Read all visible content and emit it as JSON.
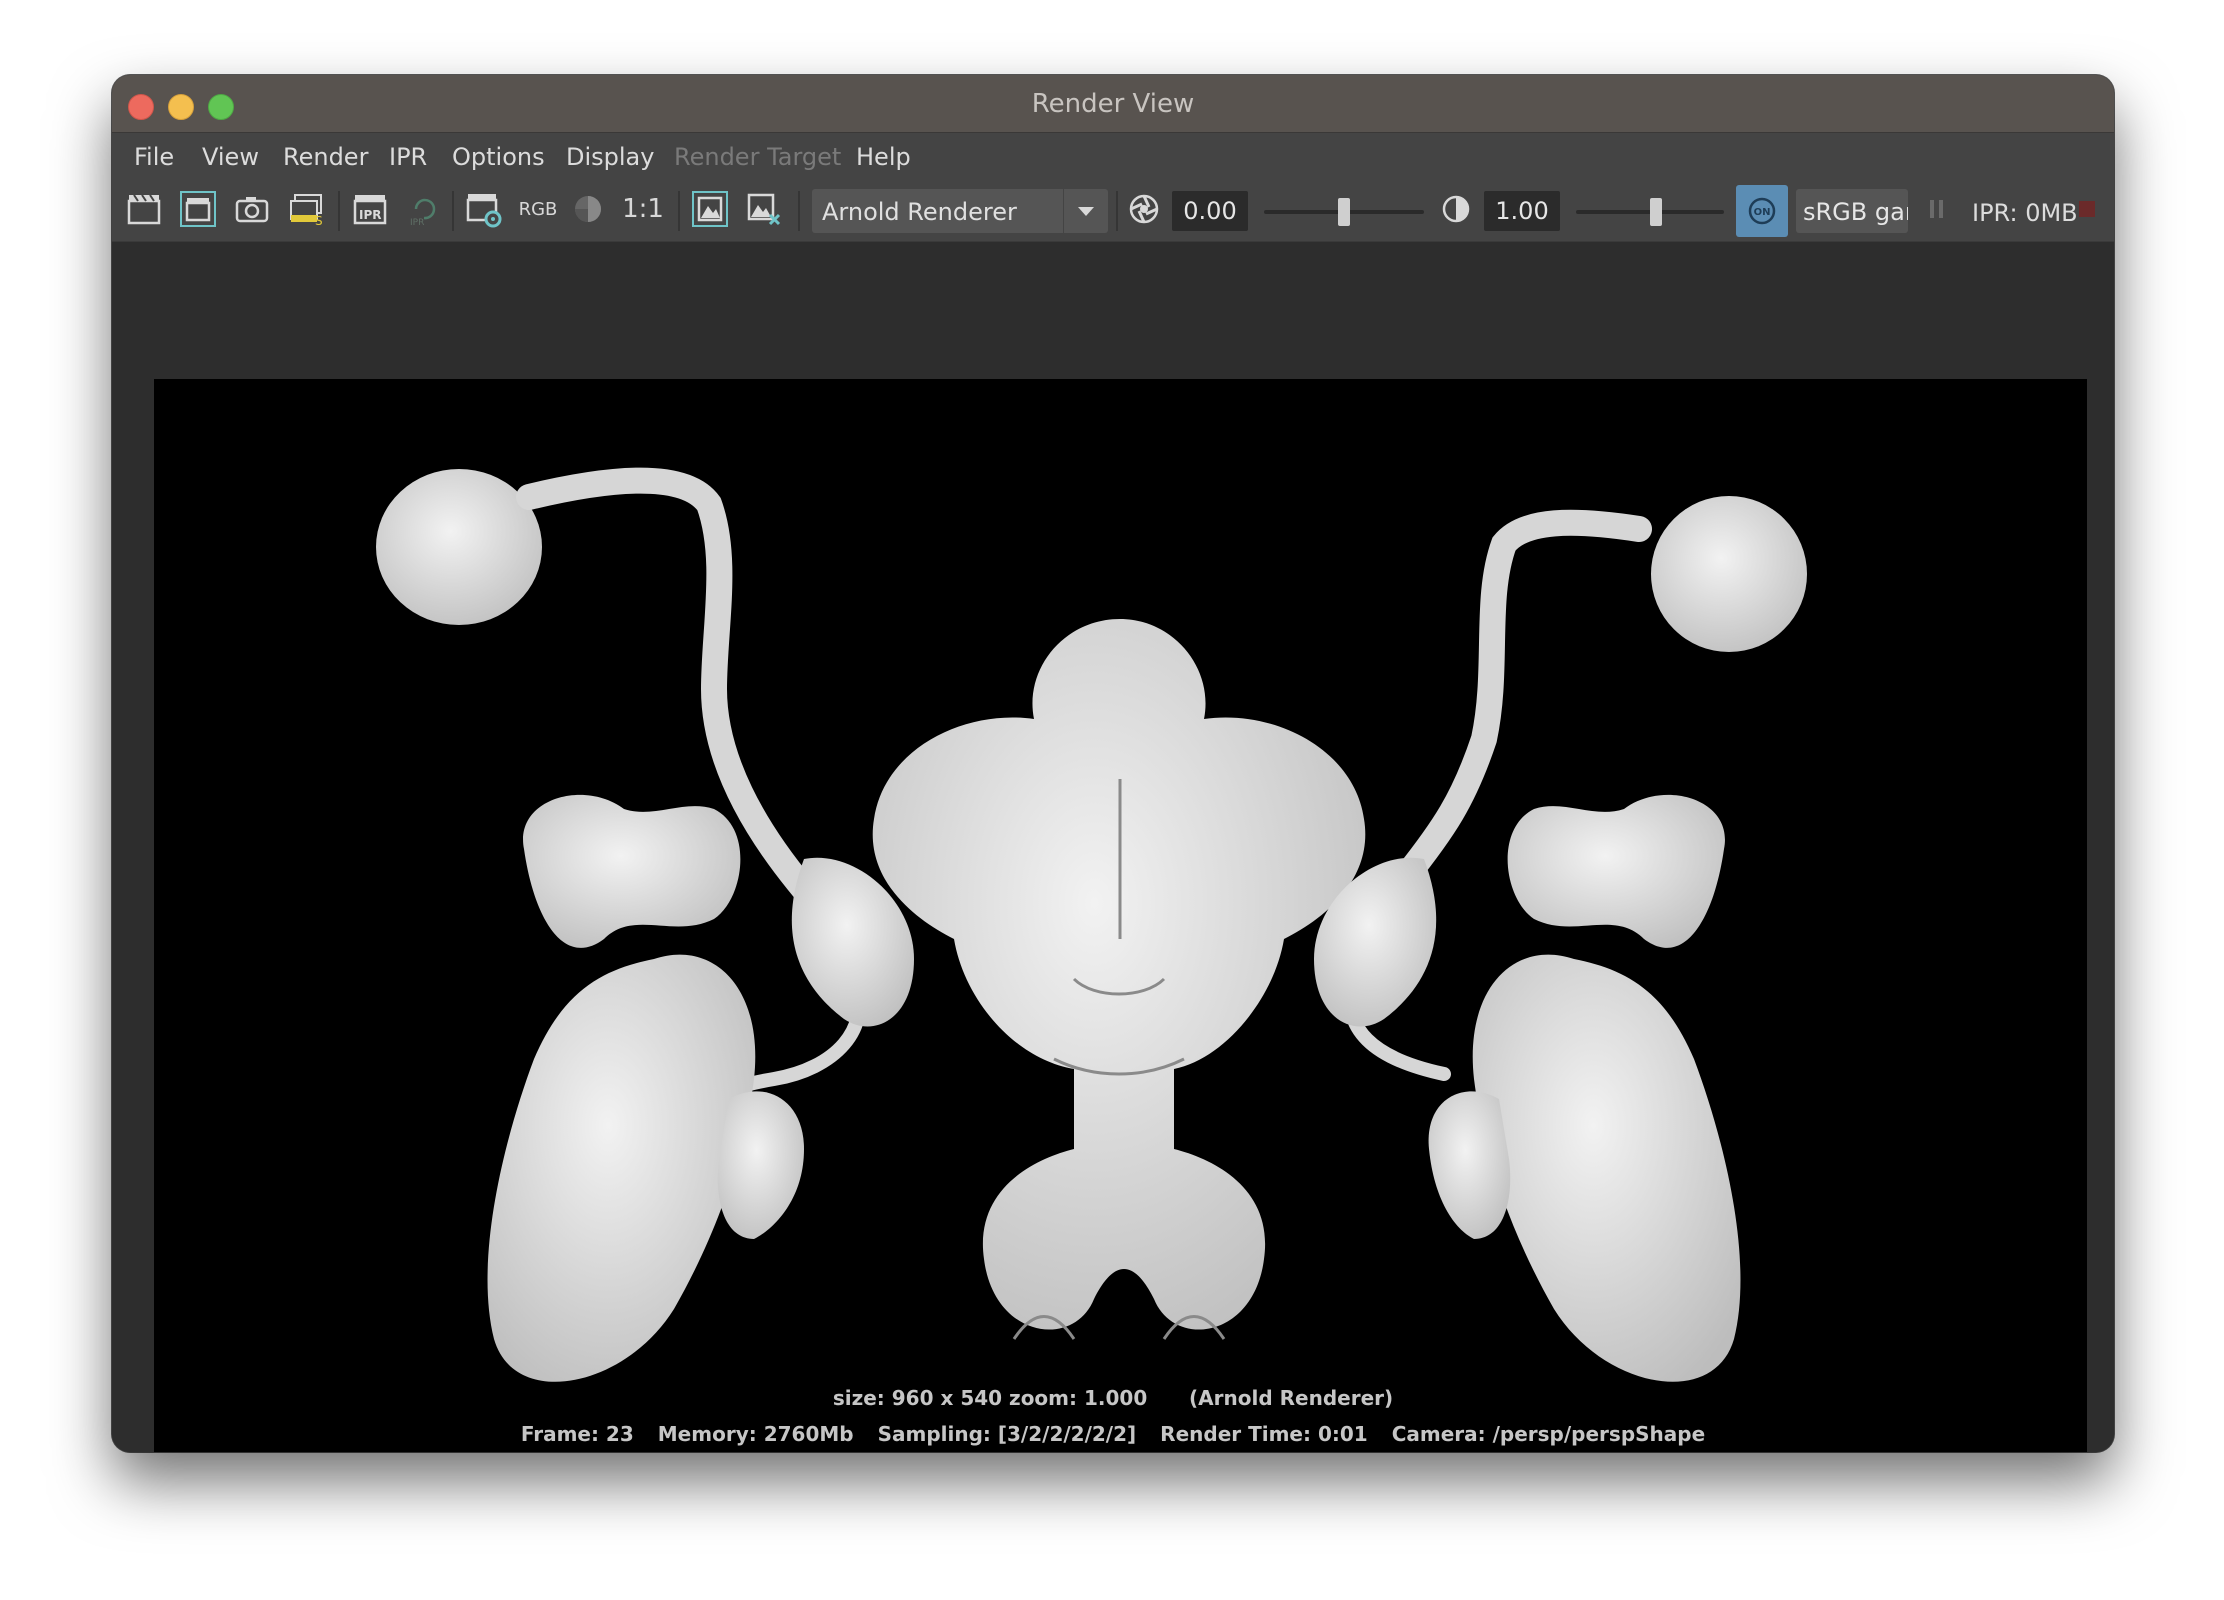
{
  "window": {
    "title": "Render View"
  },
  "menu": {
    "items": [
      {
        "label": "File",
        "enabled": true
      },
      {
        "label": "View",
        "enabled": true
      },
      {
        "label": "Render",
        "enabled": true
      },
      {
        "label": "IPR",
        "enabled": true
      },
      {
        "label": "Options",
        "enabled": true
      },
      {
        "label": "Display",
        "enabled": true
      },
      {
        "label": "Render Target",
        "enabled": false
      },
      {
        "label": "Help",
        "enabled": true
      }
    ]
  },
  "toolbar": {
    "icons": [
      "redo-previous-render-icon",
      "render-region-icon",
      "snapshot-icon",
      "render-sequence-icon",
      "ipr-render-icon",
      "refresh-ipr-icon",
      "render-settings-icon"
    ],
    "rgb_label": "RGB",
    "zoom_label": "1:1",
    "renderer": "Arnold Renderer",
    "exposure_value": "0.00",
    "exposure_level": 0.5,
    "gamma_value": "1.00",
    "gamma_level": 0.5,
    "view_transform_toggle": "ON",
    "color_space": "sRGB gamma",
    "ipr_memory": "IPR: 0MB",
    "accent_color": "#5b8db4"
  },
  "status": {
    "line1": "size: 960 x 540 zoom: 1.000",
    "line1_renderer": "(Arnold Renderer)",
    "frame": "Frame: 23",
    "memory": "Memory: 2760Mb",
    "sampling": "Sampling: [3/2/2/2/2/2]",
    "render_time": "Render Time: 0:01",
    "camera": "Camera: /persp/perspShape"
  }
}
